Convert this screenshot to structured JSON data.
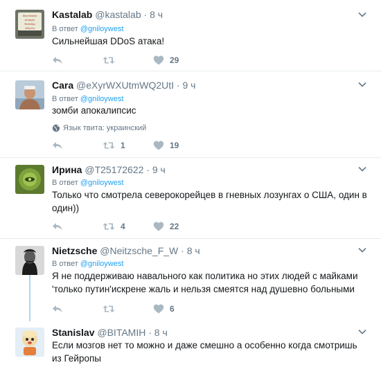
{
  "reply_prefix": "В ответ",
  "reply_mention": "@gniloywest",
  "tweets": [
    {
      "name": "Kastalab",
      "handle": "@kastalab",
      "dot": "·",
      "time": "8 ч",
      "text": "Сильнейшая DDoS атака!",
      "retweets": "",
      "likes": "29",
      "avatar_lines": [
        "Школьники",
        "атакуют",
        "Фейсбук",
        "обычно"
      ]
    },
    {
      "name": "Cara",
      "handle": "@eXyrWXUtmWQ2UtI",
      "dot": "·",
      "time": "9 ч",
      "text": "зомби апокалипсис",
      "language": "Язык твита: украинский",
      "retweets": "1",
      "likes": "19"
    },
    {
      "name": "Ирина",
      "handle": "@T25172622",
      "dot": "·",
      "time": "9 ч",
      "text": "Только что смотрела северокорейцев в гневных лозунгах о США, один в один))",
      "retweets": "4",
      "likes": "22"
    },
    {
      "name": "Nietzsche",
      "handle": "@Neitzsche_F_W",
      "dot": "·",
      "time": "8 ч",
      "text": "Я не поддерживаю навального как политика но этих людей с майками 'только путин'искрене жаль и нельзя смеятся над душевно больными",
      "retweets": "",
      "likes": "6"
    },
    {
      "name": "Stanislav",
      "handle": "@BITAMIH",
      "dot": "·",
      "time": "8 ч",
      "text": "Если мозгов нет то можно и даже смешно а особенно когда смотришь из Гейропы"
    }
  ],
  "icons": {
    "reply": "reply-icon",
    "retweet": "retweet-icon",
    "like": "heart-icon",
    "caret": "chevron-down-icon",
    "globe": "globe-icon"
  },
  "colors": {
    "link": "#1da1f2",
    "muted": "#657786",
    "action_icon": "#aab8c2",
    "separator": "#e6ecf0",
    "thread": "#a8d8ee"
  }
}
